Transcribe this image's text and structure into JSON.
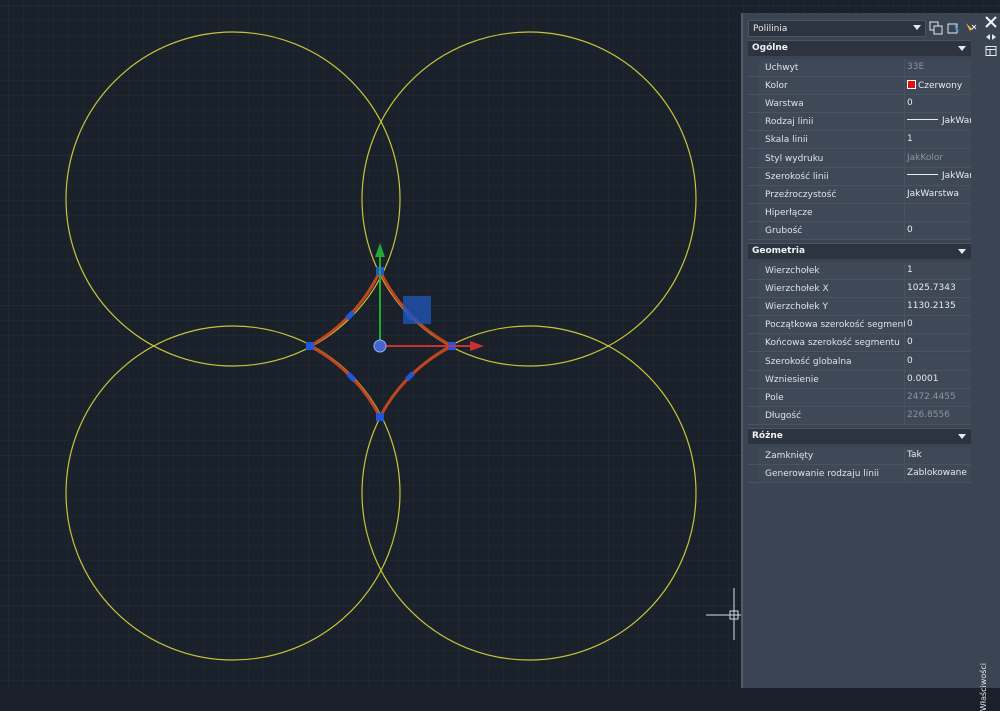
{
  "palette": {
    "object_type": "Polilinia",
    "sections": [
      {
        "name": "Ogólne",
        "rows": [
          {
            "key": "Uchwyt",
            "value": "33E",
            "readonly": true
          },
          {
            "key": "Kolor",
            "value": "Czerwony",
            "swatch": "#e01010"
          },
          {
            "key": "Warstwa",
            "value": "0"
          },
          {
            "key": "Rodzaj linii",
            "value": "JakWarstwa",
            "line": true
          },
          {
            "key": "Skala linii",
            "value": "1"
          },
          {
            "key": "Styl wydruku",
            "value": "JakKolor",
            "readonly": true
          },
          {
            "key": "Szerokość linii",
            "value": "JakWarstwa",
            "line": true
          },
          {
            "key": "Przeźroczystość",
            "value": "JakWarstwa"
          },
          {
            "key": "Hiperłącze",
            "value": ""
          },
          {
            "key": "Grubość",
            "value": "0"
          }
        ]
      },
      {
        "name": "Geometria",
        "rows": [
          {
            "key": "Wierzchołek",
            "value": "1"
          },
          {
            "key": "Wierzchołek X",
            "value": "1025.7343"
          },
          {
            "key": "Wierzchołek Y",
            "value": "1130.2135"
          },
          {
            "key": "Początkowa szerokość segmentu",
            "value": "0"
          },
          {
            "key": "Końcowa szerokość segmentu",
            "value": "0"
          },
          {
            "key": "Szerokość globalna",
            "value": "0"
          },
          {
            "key": "Wzniesienie",
            "value": "0.0001"
          },
          {
            "key": "Pole",
            "value": "2472.4455",
            "readonly": true
          },
          {
            "key": "Długość",
            "value": "226.8556",
            "readonly": true
          }
        ]
      },
      {
        "name": "Różne",
        "rows": [
          {
            "key": "Zamknięty",
            "value": "Tak"
          },
          {
            "key": "Generowanie rodzaju linii",
            "value": "Zablokowane"
          }
        ]
      }
    ]
  },
  "side_tab": "Właściwości",
  "colors": {
    "background": "#1a212b",
    "circles": "#c8c43a",
    "polyline": "#c0461f",
    "grip": "#2255dd",
    "gizmo_y": "#22aa33",
    "gizmo_x": "#cc3030"
  },
  "icons": [
    "dropdown-arrow-icon",
    "quick-select-icon",
    "select-objects-icon",
    "toggle-pickadd-icon",
    "close-icon",
    "pin-icon",
    "properties-icon"
  ]
}
